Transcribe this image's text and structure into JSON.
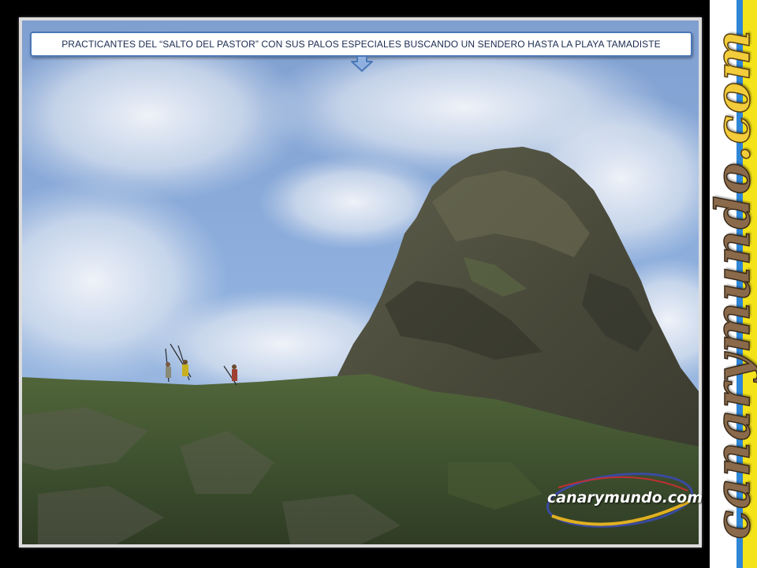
{
  "slide": {
    "caption": "PRACTICANTES DEL “SALTO DEL PASTOR” CON SUS PALOS ESPECIALES BUSCANDO UN SENDERO HASTA LA PLAYA TAMADISTE",
    "arrow_icon": "down-arrow-icon"
  },
  "branding": {
    "side_logo_main": "canarymundo",
    "side_logo_tld": ".com",
    "watermark": "canarymundo.com",
    "colors": {
      "blue_stripe": "#2f86d6",
      "yellow_stripe": "#f4e21a",
      "logo_brown": "#8a6a4a",
      "logo_gold": "#f2cc3a",
      "caption_border": "#4a78b6"
    }
  },
  "photo": {
    "subject": "hikers-with-poles-on-ridge-below-rock-peak"
  }
}
